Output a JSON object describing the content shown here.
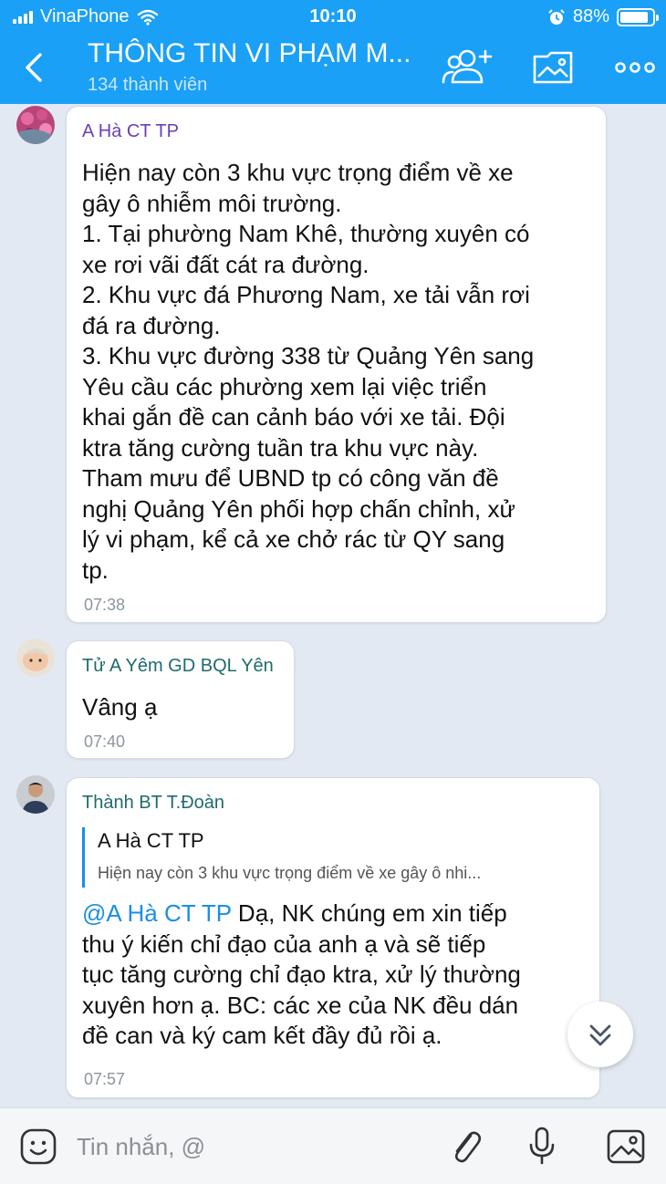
{
  "status_bar": {
    "carrier": "VinaPhone",
    "time": "10:10",
    "battery": "88%",
    "battery_level": 0.88
  },
  "header": {
    "title": "THÔNG TIN VI PHẠM M...",
    "subtitle": "134 thành viên"
  },
  "messages": [
    {
      "sender": "A Hà CT TP",
      "sender_color": "#6a3fb5",
      "text": "Hiện nay còn 3 khu vực trọng điểm về xe\ngây ô nhiễm môi trường.\n1. Tại phường Nam Khê, thường xuyên có\nxe rơi vãi đất cát ra đường.\n2. Khu vực đá Phương Nam, xe tải vẫn rơi\nđá ra đường.\n3. Khu vực đường 338 từ Quảng Yên sang\nYêu cầu các phường xem lại việc triển\nkhai gắn đề can cảnh báo với xe tải. Đội\nktra tăng cường tuần tra khu vực này.\nTham mưu để UBND tp có công văn đề\nnghị Quảng Yên phối hợp chấn chỉnh, xử\nlý  vi phạm, kể cả xe chở rác từ QY sang\ntp.",
      "time": "07:38"
    },
    {
      "sender": "Tử A Yêm GD BQL Yên",
      "sender_color": "#1f6b6b",
      "text": "Vâng ạ",
      "time": "07:40"
    },
    {
      "sender": "Thành BT T.Đoàn",
      "sender_color": "#1f6b6b",
      "quote": {
        "name": "A Hà CT TP",
        "text": "Hiện nay còn 3 khu vực trọng điểm về xe gây ô nhi..."
      },
      "mention": "@A Hà CT TP",
      "text": " Dạ, NK chúng em xin tiếp\nthu ý kiến chỉ đạo của anh ạ và sẽ tiếp\ntục tăng cường chỉ đạo ktra, xử lý thường\nxuyên hơn ạ. BC: các xe của NK đều dán\nđề can và ký cam kết đầy đủ rồi ạ.",
      "time": "07:57"
    }
  ],
  "input": {
    "placeholder": "Tin nhắn, @",
    "value": ""
  },
  "icons": {
    "back": "chevron-left-icon",
    "add_member": "add-user-icon",
    "album": "folder-image-icon",
    "more": "more-icon",
    "emoji": "emoji-icon",
    "attach": "paperclip-icon",
    "mic": "microphone-icon",
    "image": "image-icon",
    "scroll_down": "double-chevron-down-icon"
  },
  "colors": {
    "header_bg": "#1aa0f7",
    "chat_bg": "#e3e9f2",
    "link": "#1a8fe3"
  }
}
